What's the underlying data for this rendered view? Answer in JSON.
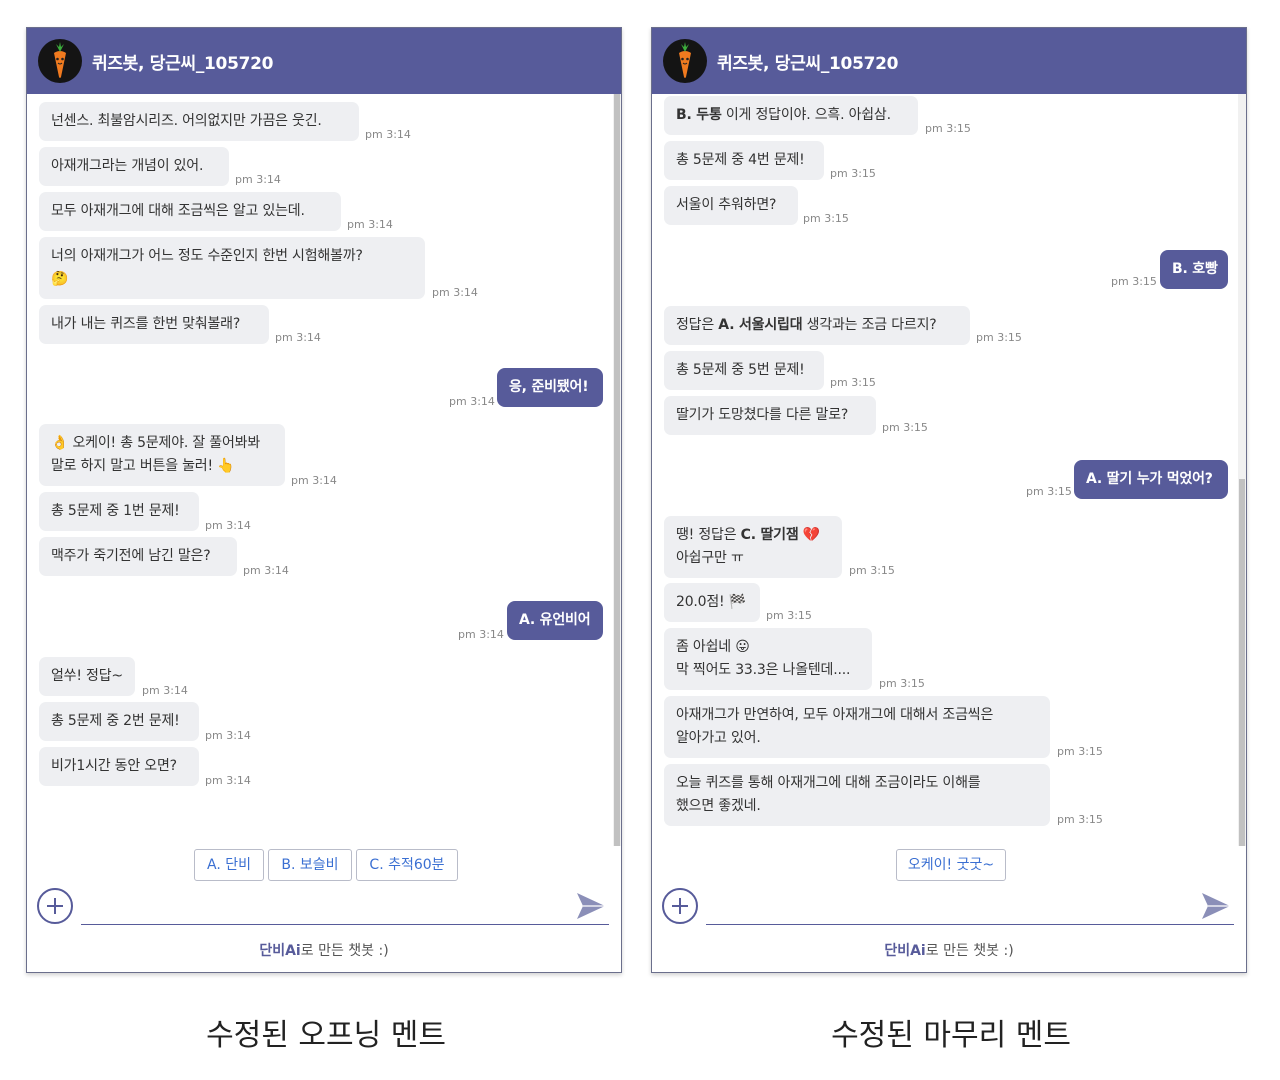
{
  "colors": {
    "header": "#575b9a",
    "user_bubble": "#575b9a",
    "bot_bubble": "#eeeff2",
    "quick_reply_text": "#3a6fd2"
  },
  "panels": [
    {
      "title": "퀴즈봇, 당근씨_105720",
      "avatar_icon": "carrot-icon",
      "messages": [
        {
          "from": "bot",
          "text": "넌센스. 최불암시리즈. 어의없지만 가끔은 웃긴.",
          "time": "pm 3:14"
        },
        {
          "from": "bot",
          "text": "아재개그라는 개념이 있어.",
          "time": "pm 3:14"
        },
        {
          "from": "bot",
          "text": "모두 아재개그에 대해 조금씩은 알고 있는데.",
          "time": "pm 3:14"
        },
        {
          "from": "bot",
          "text": "너의 아재개그가 어느 정도 수준인지 한번 시험해볼까?",
          "emoji": "🤔",
          "emoji_name": "thinking-face-emoji",
          "time": "pm 3:14"
        },
        {
          "from": "bot",
          "text": "내가 내는 퀴즈를 한번 맞춰볼래?",
          "time": "pm 3:14"
        },
        {
          "from": "user",
          "text": "응, 준비됐어!",
          "time": "pm 3:14"
        },
        {
          "from": "bot",
          "lead_emoji": "👌",
          "lead_emoji_name": "ok-hand-emoji",
          "text": "오케이! 총 5문제야. 잘 풀어봐봐",
          "text2": "말로 하지 말고 버튼을 눌러!",
          "emoji": "👆",
          "emoji_name": "pointing-hand-emoji",
          "time": "pm 3:14"
        },
        {
          "from": "bot",
          "text": "총 5문제 중 1번 문제!",
          "time": "pm 3:14"
        },
        {
          "from": "bot",
          "text": "맥주가 죽기전에 남긴 말은?",
          "time": "pm 3:14"
        },
        {
          "from": "user",
          "text": "A. 유언비어",
          "time": "pm 3:14"
        },
        {
          "from": "bot",
          "text": "얼쑤! 정답~",
          "time": "pm 3:14"
        },
        {
          "from": "bot",
          "text": "총 5문제 중 2번 문제!",
          "time": "pm 3:14"
        },
        {
          "from": "bot",
          "text": "비가1시간 동안 오면?",
          "time": "pm 3:14"
        }
      ],
      "quick_replies": [
        "A. 단비",
        "B. 보슬비",
        "C. 추적60분"
      ],
      "input": {
        "value": "",
        "placeholder": ""
      },
      "footer": {
        "brand": "단비Ai",
        "text": "로 만든 챗봇 :)"
      },
      "caption": "수정된 오프닝 멘트",
      "scroll_position": 0.95
    },
    {
      "title": "퀴즈봇, 당근씨_105720",
      "avatar_icon": "carrot-icon",
      "messages": [
        {
          "from": "bot",
          "bold": "B. 두통",
          "text": " 이게 정답이야. 으흑. 아쉽삼.",
          "time": "pm 3:15"
        },
        {
          "from": "bot",
          "text": "총 5문제 중 4번 문제!",
          "time": "pm 3:15"
        },
        {
          "from": "bot",
          "text": "서울이 추워하면?",
          "time": "pm 3:15"
        },
        {
          "from": "user",
          "text": "B. 호빵",
          "time": "pm 3:15"
        },
        {
          "from": "bot",
          "text_before": "정답은 ",
          "bold": "A. 서울시립대",
          "text": " 생각과는 조금 다르지?",
          "time": "pm 3:15"
        },
        {
          "from": "bot",
          "text": "총 5문제 중 5번 문제!",
          "time": "pm 3:15"
        },
        {
          "from": "bot",
          "text": "딸기가 도망쳤다를 다른 말로?",
          "time": "pm 3:15"
        },
        {
          "from": "user",
          "text": "A. 딸기 누가 먹었어?",
          "time": "pm 3:15"
        },
        {
          "from": "bot",
          "text_before": "땡! 정답은 ",
          "bold": "C. 딸기잼",
          "emoji": "💔",
          "emoji_name": "broken-heart-emoji",
          "text2": "아쉽구만 ㅠ",
          "time": "pm 3:15"
        },
        {
          "from": "bot",
          "text": "20.0점!",
          "emoji": "🏁",
          "emoji_name": "checkered-flag-emoji",
          "time": "pm 3:15"
        },
        {
          "from": "bot",
          "text": "좀 아쉽네",
          "emoji": "😛",
          "emoji_name": "tongue-face-emoji",
          "text2": "막 찍어도 33.3은 나올텐데....",
          "time": "pm 3:15"
        },
        {
          "from": "bot",
          "text": "아재개그가 만연하여, 모두 아재개그에 대해서 조금씩은",
          "text2": "알아가고 있어.",
          "time": "pm 3:15"
        },
        {
          "from": "bot",
          "text": "오늘 퀴즈를 통해 아재개그에 대해 조금이라도 이해를",
          "text2": "했으면 좋겠네.",
          "time": "pm 3:15"
        }
      ],
      "quick_replies": [
        "오케이! 굿굿~"
      ],
      "input": {
        "value": "",
        "placeholder": ""
      },
      "footer": {
        "brand": "단비Ai",
        "text": "로 만든 챗봇 :)"
      },
      "caption": "수정된 마무리 멘트",
      "scroll_position": 1.0
    }
  ]
}
